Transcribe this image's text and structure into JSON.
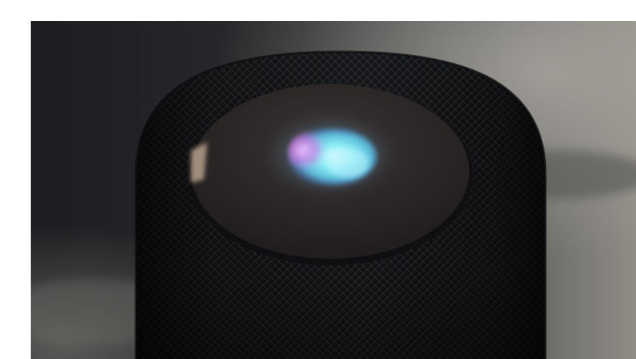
{
  "image": {
    "subject": "smart-speaker",
    "colors": {
      "background_dark": "#1f2022",
      "background_light": "#8a8884",
      "speaker_mesh": "#1a1b1d",
      "top_disc": "#2a2626",
      "siri_cyan": "#6fe3f0",
      "siri_magenta": "#d77be6",
      "siri_blue": "#4a7dff"
    }
  }
}
